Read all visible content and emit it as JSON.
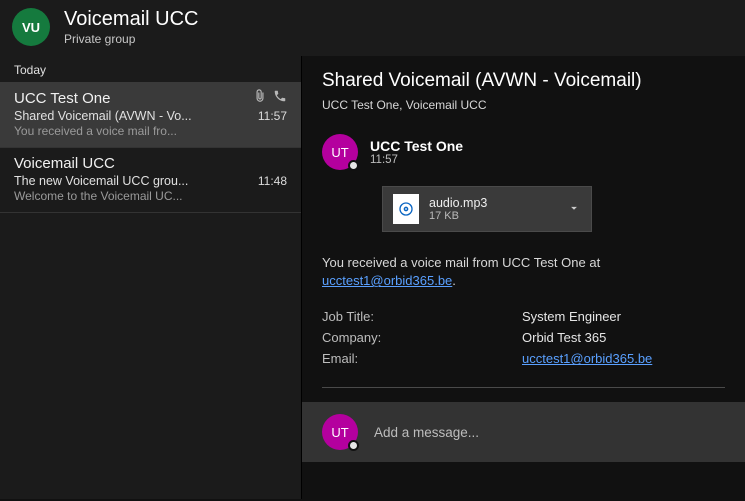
{
  "header": {
    "avatar_initials": "VU",
    "title": "Voicemail UCC",
    "subtitle": "Private group"
  },
  "list": {
    "section": "Today",
    "items": [
      {
        "sender": "UCC Test One",
        "subject": "Shared Voicemail (AVWN - Vo...",
        "preview": "You received a voice mail fro...",
        "time": "11:57",
        "has_attachment": true,
        "has_call": true,
        "selected": true
      },
      {
        "sender": "Voicemail UCC",
        "subject": "The new Voicemail UCC grou...",
        "preview": "Welcome to the Voicemail UC...",
        "time": "11:48",
        "has_attachment": false,
        "has_call": false,
        "selected": false
      }
    ]
  },
  "message": {
    "title": "Shared Voicemail (AVWN - Voicemail)",
    "recipients": "UCC Test One, Voicemail UCC",
    "sender_initials": "UT",
    "sender_name": "UCC Test One",
    "sent_time": "11:57",
    "attachment": {
      "name": "audio.mp3",
      "size": "17 KB"
    },
    "body_prefix": "You received a voice mail from UCC Test One at ",
    "body_link": "ucctest1@orbid365.be",
    "body_suffix": ".",
    "info": {
      "job_label": "Job Title:",
      "job_value": "System Engineer",
      "company_label": "Company:",
      "company_value": "Orbid Test 365",
      "email_label": "Email:",
      "email_value": "ucctest1@orbid365.be"
    }
  },
  "reply": {
    "avatar_initials": "UT",
    "placeholder": "Add a message..."
  }
}
